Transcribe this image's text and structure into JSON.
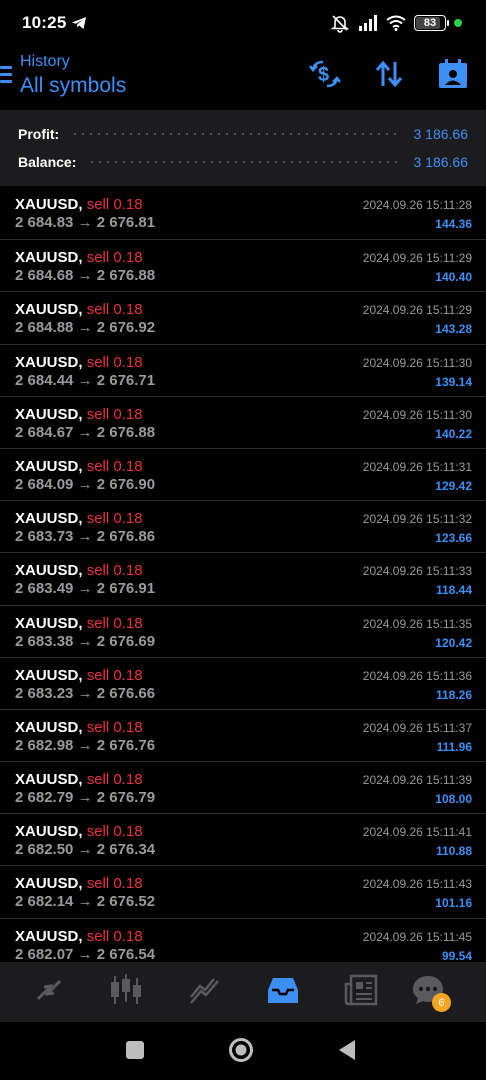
{
  "status_bar": {
    "time": "10:25",
    "battery": "83",
    "icons": [
      "telegram-icon",
      "mute-icon",
      "signal-icon",
      "wifi-icon",
      "battery-icon",
      "notification-dot"
    ]
  },
  "header": {
    "subtitle": "History",
    "title": "All symbols",
    "buttons": [
      "currency-exchange-icon",
      "sort-icon",
      "calendar-user-icon"
    ]
  },
  "summary": {
    "profit_label": "Profit:",
    "profit_value": "3 186.66",
    "balance_label": "Balance:",
    "balance_value": "3 186.66"
  },
  "trades": [
    {
      "symbol": "XAUUSD,",
      "side": "sell 0.18",
      "prices": "2 684.83 → 2 676.81",
      "time": "2024.09.26 15:11:28",
      "profit": "144.36"
    },
    {
      "symbol": "XAUUSD,",
      "side": "sell 0.18",
      "prices": "2 684.68 → 2 676.88",
      "time": "2024.09.26 15:11:29",
      "profit": "140.40"
    },
    {
      "symbol": "XAUUSD,",
      "side": "sell 0.18",
      "prices": "2 684.88 → 2 676.92",
      "time": "2024.09.26 15:11:29",
      "profit": "143.28"
    },
    {
      "symbol": "XAUUSD,",
      "side": "sell 0.18",
      "prices": "2 684.44 → 2 676.71",
      "time": "2024.09.26 15:11:30",
      "profit": "139.14"
    },
    {
      "symbol": "XAUUSD,",
      "side": "sell 0.18",
      "prices": "2 684.67 → 2 676.88",
      "time": "2024.09.26 15:11:30",
      "profit": "140.22"
    },
    {
      "symbol": "XAUUSD,",
      "side": "sell 0.18",
      "prices": "2 684.09 → 2 676.90",
      "time": "2024.09.26 15:11:31",
      "profit": "129.42"
    },
    {
      "symbol": "XAUUSD,",
      "side": "sell 0.18",
      "prices": "2 683.73 → 2 676.86",
      "time": "2024.09.26 15:11:32",
      "profit": "123.66"
    },
    {
      "symbol": "XAUUSD,",
      "side": "sell 0.18",
      "prices": "2 683.49 → 2 676.91",
      "time": "2024.09.26 15:11:33",
      "profit": "118.44"
    },
    {
      "symbol": "XAUUSD,",
      "side": "sell 0.18",
      "prices": "2 683.38 → 2 676.69",
      "time": "2024.09.26 15:11:35",
      "profit": "120.42"
    },
    {
      "symbol": "XAUUSD,",
      "side": "sell 0.18",
      "prices": "2 683.23 → 2 676.66",
      "time": "2024.09.26 15:11:36",
      "profit": "118.26"
    },
    {
      "symbol": "XAUUSD,",
      "side": "sell 0.18",
      "prices": "2 682.98 → 2 676.76",
      "time": "2024.09.26 15:11:37",
      "profit": "111.96"
    },
    {
      "symbol": "XAUUSD,",
      "side": "sell 0.18",
      "prices": "2 682.79 → 2 676.79",
      "time": "2024.09.26 15:11:39",
      "profit": "108.00"
    },
    {
      "symbol": "XAUUSD,",
      "side": "sell 0.18",
      "prices": "2 682.50 → 2 676.34",
      "time": "2024.09.26 15:11:41",
      "profit": "110.88"
    },
    {
      "symbol": "XAUUSD,",
      "side": "sell 0.18",
      "prices": "2 682.14 → 2 676.52",
      "time": "2024.09.26 15:11:43",
      "profit": "101.16"
    },
    {
      "symbol": "XAUUSD,",
      "side": "sell 0.18",
      "prices": "2 682.07 → 2 676.54",
      "time": "2024.09.26 15:11:45",
      "profit": "99.54"
    }
  ],
  "bottom_nav": {
    "items": [
      "quotes-icon",
      "chart-icon",
      "trade-icon",
      "history-icon",
      "news-icon",
      "chat-icon"
    ],
    "active": "history-icon",
    "chat_badge": "6",
    "accent": "#3d8ff5",
    "inactive": "#5a5a5e"
  },
  "colors": {
    "accent": "#3d8ff5",
    "sell": "#e8323c",
    "muted": "#9a9a9e",
    "badge": "#f5a623"
  }
}
